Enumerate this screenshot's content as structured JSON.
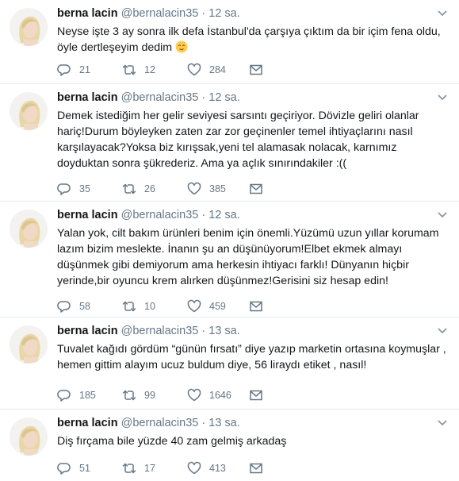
{
  "icons": {
    "reply": "reply-icon",
    "retweet": "retweet-icon",
    "like": "heart-icon",
    "dm": "envelope-icon",
    "caret": "chevron-down-icon",
    "emoji": "relieved-face-emoji"
  },
  "colors": {
    "secondary": "#657786",
    "divider": "#e6ecf0",
    "text": "#14171a"
  },
  "tweets": [
    {
      "name": "berna lacin",
      "handle": "@bernalacin35",
      "separator": "·",
      "time": "12 sa.",
      "text": "Neyse işte 3 ay sonra ilk defa İstanbul'da çarşıya çıktım da bir içim fena oldu, öyle dertleşeyim dedim",
      "replies": "21",
      "retweets": "12",
      "likes": "284"
    },
    {
      "name": "berna lacin",
      "handle": "@bernalacin35",
      "separator": "·",
      "time": "12 sa.",
      "text": "Demek istediğim her gelir seviyesi sarsıntı geçiriyor. Dövizle geliri olanlar hariç!Durum böyleyken zaten zar zor geçinenler temel ihtiyaçlarını nasıl karşılayacak?Yoksa biz kırışsak,yeni tel alamasak nolacak, karnımız doyduktan sonra şükrederiz. Ama ya açlık sınırındakiler :((",
      "replies": "35",
      "retweets": "26",
      "likes": "385"
    },
    {
      "name": "berna lacin",
      "handle": "@bernalacin35",
      "separator": "·",
      "time": "12 sa.",
      "text": "Yalan yok, cilt bakım ürünleri benim için önemli.Yüzümü uzun yıllar korumam lazım bizim meslekte. İnanın şu an düşünüyorum!Elbet ekmek almayı düşünmek gibi demiyorum ama herkesin ihtiyacı farklı! Dünyanın hiçbir yerinde,bir oyuncu krem alırken  düşünmez!Gerisini siz hesap edin!",
      "replies": "58",
      "retweets": "10",
      "likes": "459"
    },
    {
      "name": "berna lacin",
      "handle": "@bernalacin35",
      "separator": "·",
      "time": "13 sa.",
      "text": "Tuvalet kağıdı gördüm “günün fırsatı” diye yazıp marketin ortasına koymuşlar , hemen gittim alayım ucuz buldum diye, 56 liraydı etiket , nasıl!",
      "replies": "185",
      "retweets": "99",
      "likes": "1646"
    },
    {
      "name": "berna lacin",
      "handle": "@bernalacin35",
      "separator": "·",
      "time": "13 sa.",
      "text": "Diş fırçama bile yüzde 40 zam gelmiş arkadaş",
      "replies": "51",
      "retweets": "17",
      "likes": "413"
    }
  ]
}
